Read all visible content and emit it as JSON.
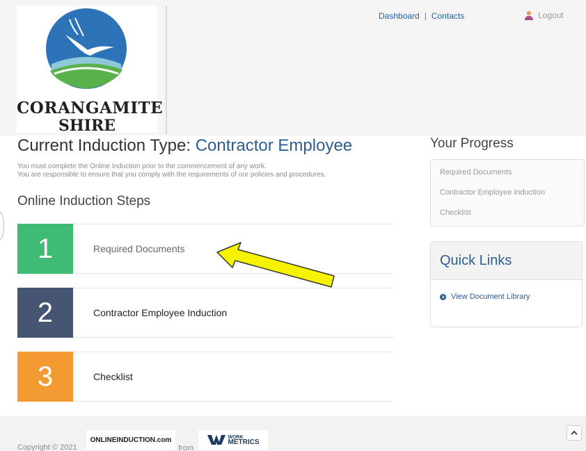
{
  "header": {
    "logo_line1": "CORANGAMITE",
    "logo_line2": "SHIRE",
    "nav": {
      "dashboard": "Dashboard",
      "separator": "|",
      "contacts": "Contacts"
    },
    "logout": "Logout"
  },
  "main": {
    "title_prefix": "Current Induction Type: ",
    "title_type": "Contractor Employee",
    "intro_line1": "You must complete the Online Induction prior to the commencement of any work.",
    "intro_line2": "You are responsible to ensure that you comply with the requirements of our policies and procedures.",
    "steps_heading": "Online Induction Steps",
    "steps": [
      {
        "number": "1",
        "label": "Required Documents",
        "color": "#3fbb75"
      },
      {
        "number": "2",
        "label": "Contractor Employee Induction",
        "color": "#465572"
      },
      {
        "number": "3",
        "label": "Checklist",
        "color": "#f39b32"
      }
    ]
  },
  "sidebar": {
    "progress_title": "Your Progress",
    "progress_items": [
      "Required Documents",
      "Contractor Employee Induction",
      "Checklist"
    ],
    "quick_links_title": "Quick Links",
    "quick_links": [
      "View Document Library"
    ]
  },
  "footer": {
    "copyright": "Copyright © 2021",
    "brand1": "ONLINEINDUCTION.com",
    "from": "from",
    "brand2_line1": "WORK",
    "brand2_line2": "METRICS"
  },
  "colors": {
    "accent": "#2f5d8e",
    "link": "#1f5fa8",
    "arrow": "#f7f300"
  }
}
